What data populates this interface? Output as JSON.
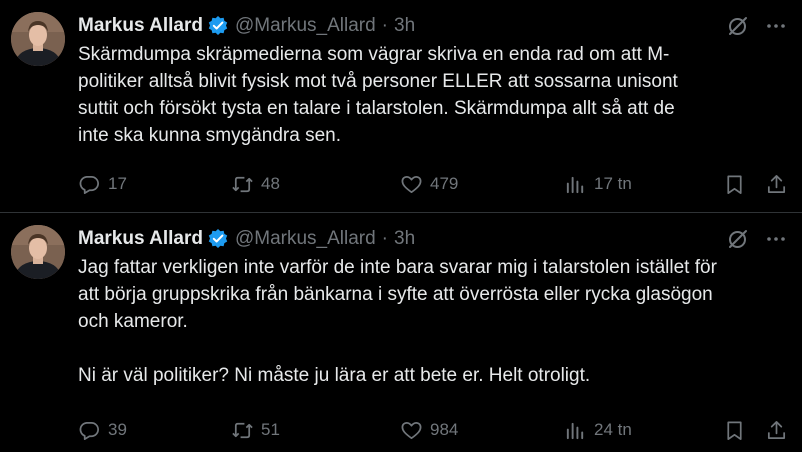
{
  "colors": {
    "background": "#000000",
    "text": "#e7e9ea",
    "secondary": "#71767b",
    "verified": "#1d9bf0",
    "divider": "#2f3336"
  },
  "tweets": [
    {
      "author": {
        "name": "Markus Allard",
        "handle": "@Markus_Allard",
        "verified": true
      },
      "separator": "·",
      "time": "3h",
      "text": "Skärmdumpa skräpmedierna som vägrar skriva en enda rad om att M-\npolitiker alltså blivit fysisk mot två personer ELLER att sossarna unisont\nsuttit och försökt tysta en talare i talarstolen. Skärmdumpa allt så att de\ninte ska kunna smygändra sen.",
      "stats": {
        "replies": "17",
        "reposts": "48",
        "likes": "479",
        "views": "17 tn"
      }
    },
    {
      "author": {
        "name": "Markus Allard",
        "handle": "@Markus_Allard",
        "verified": true
      },
      "separator": "·",
      "time": "3h",
      "text": "Jag fattar verkligen inte varför de inte bara svarar mig i talarstolen istället för\natt börja gruppskrika från bänkarna i syfte att överrösta eller rycka glasögon\noch kameror.\n\nNi är väl politiker? Ni måste ju lära er att bete er. Helt otroligt.",
      "stats": {
        "replies": "39",
        "reposts": "51",
        "likes": "984",
        "views": "24 tn"
      }
    }
  ],
  "icons": {
    "verified": "verified-badge-icon",
    "grok": "grok-icon",
    "more": "more-icon",
    "reply": "reply-icon",
    "repost": "repost-icon",
    "like": "like-icon",
    "views": "views-icon",
    "bookmark": "bookmark-icon",
    "share": "share-icon"
  }
}
